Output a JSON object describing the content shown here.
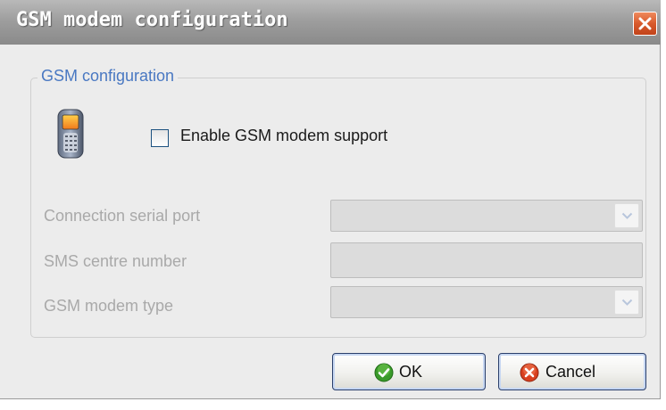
{
  "window": {
    "title": "GSM modem configuration"
  },
  "group": {
    "label": "GSM configuration",
    "checkbox": {
      "label": "Enable GSM modem support",
      "checked": false
    }
  },
  "fields": {
    "serial_port": {
      "label": "Connection serial port",
      "value": "",
      "enabled": false
    },
    "sms_centre": {
      "label": "SMS centre number",
      "value": "",
      "enabled": false
    },
    "modem_type": {
      "label": "GSM modem type",
      "value": "",
      "enabled": false
    }
  },
  "buttons": {
    "ok": "OK",
    "cancel": "Cancel"
  },
  "icons": {
    "title_close": "close-icon",
    "phone": "mobile-phone-icon",
    "ok": "green-check-icon",
    "cancel": "red-x-icon",
    "dropdown": "chevron-down-icon"
  },
  "colors": {
    "titlebar": "#9e9e9e",
    "group_label": "#4978c2",
    "disabled_text": "#a9a9a9",
    "close_button": "#d85a2c"
  }
}
